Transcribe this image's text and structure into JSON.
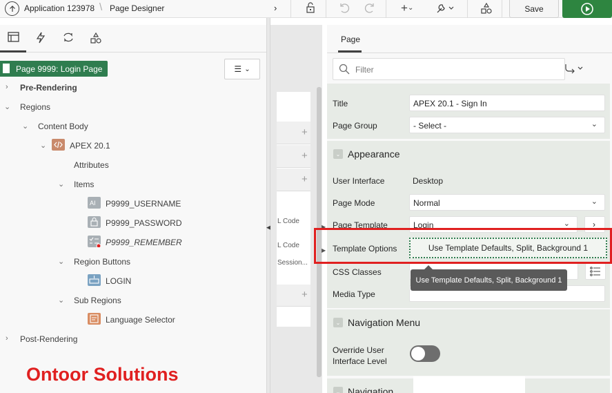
{
  "toolbar": {
    "app_title": "Application 123978",
    "separator": "\\",
    "page_designer": "Page Designer",
    "save_label": "Save",
    "icons": [
      "up-arrow-icon",
      "lock-icon",
      "undo-icon",
      "redo-icon",
      "plus-icon",
      "wrench-icon",
      "shared-components-icon",
      "run-icon"
    ]
  },
  "left": {
    "tabs": [
      "layout-tab-icon",
      "dynamic-actions-icon",
      "processing-icon",
      "shared-components-icon"
    ],
    "page_badge": "Page 9999: Login Page",
    "tree": [
      {
        "label": "Pre-Rendering",
        "bold": true
      },
      {
        "label": "Regions",
        "bold": false
      },
      {
        "label": "Content Body"
      },
      {
        "label": "APEX 20.1"
      },
      {
        "label": "Attributes"
      },
      {
        "label": "Items"
      },
      {
        "label": "P9999_USERNAME"
      },
      {
        "label": "P9999_PASSWORD"
      },
      {
        "label": "P9999_REMEMBER"
      },
      {
        "label": "Region Buttons"
      },
      {
        "label": "LOGIN"
      },
      {
        "label": "Sub Regions"
      },
      {
        "label": "Language Selector"
      },
      {
        "label": "Post-Rendering"
      }
    ]
  },
  "watermark": "Ontoor Solutions",
  "middle": {
    "snippets": [
      "L Code",
      "L Code",
      "Session..."
    ]
  },
  "right": {
    "tab": "Page",
    "filter_placeholder": "Filter",
    "title_label": "Title",
    "title_value": "APEX 20.1 - Sign In",
    "page_group_label": "Page Group",
    "page_group_value": "- Select -",
    "appearance_header": "Appearance",
    "user_interface_label": "User Interface",
    "user_interface_value": "Desktop",
    "page_mode_label": "Page Mode",
    "page_mode_value": "Normal",
    "page_template_label": "Page Template",
    "page_template_value": "Login",
    "template_options_label": "Template Options",
    "template_options_value": "Use Template Defaults, Split, Background 1",
    "tooltip": "Use Template Defaults, Split, Background 1",
    "css_classes_label": "CSS Classes",
    "media_type_label": "Media Type",
    "nav_menu_header": "Navigation Menu",
    "override_ui_label": "Override User Interface Level",
    "navigation_header": "Navigation"
  },
  "colors": {
    "accent_green": "#2f7d4f",
    "run_green": "#2e8540",
    "highlight_red": "#e02020"
  }
}
